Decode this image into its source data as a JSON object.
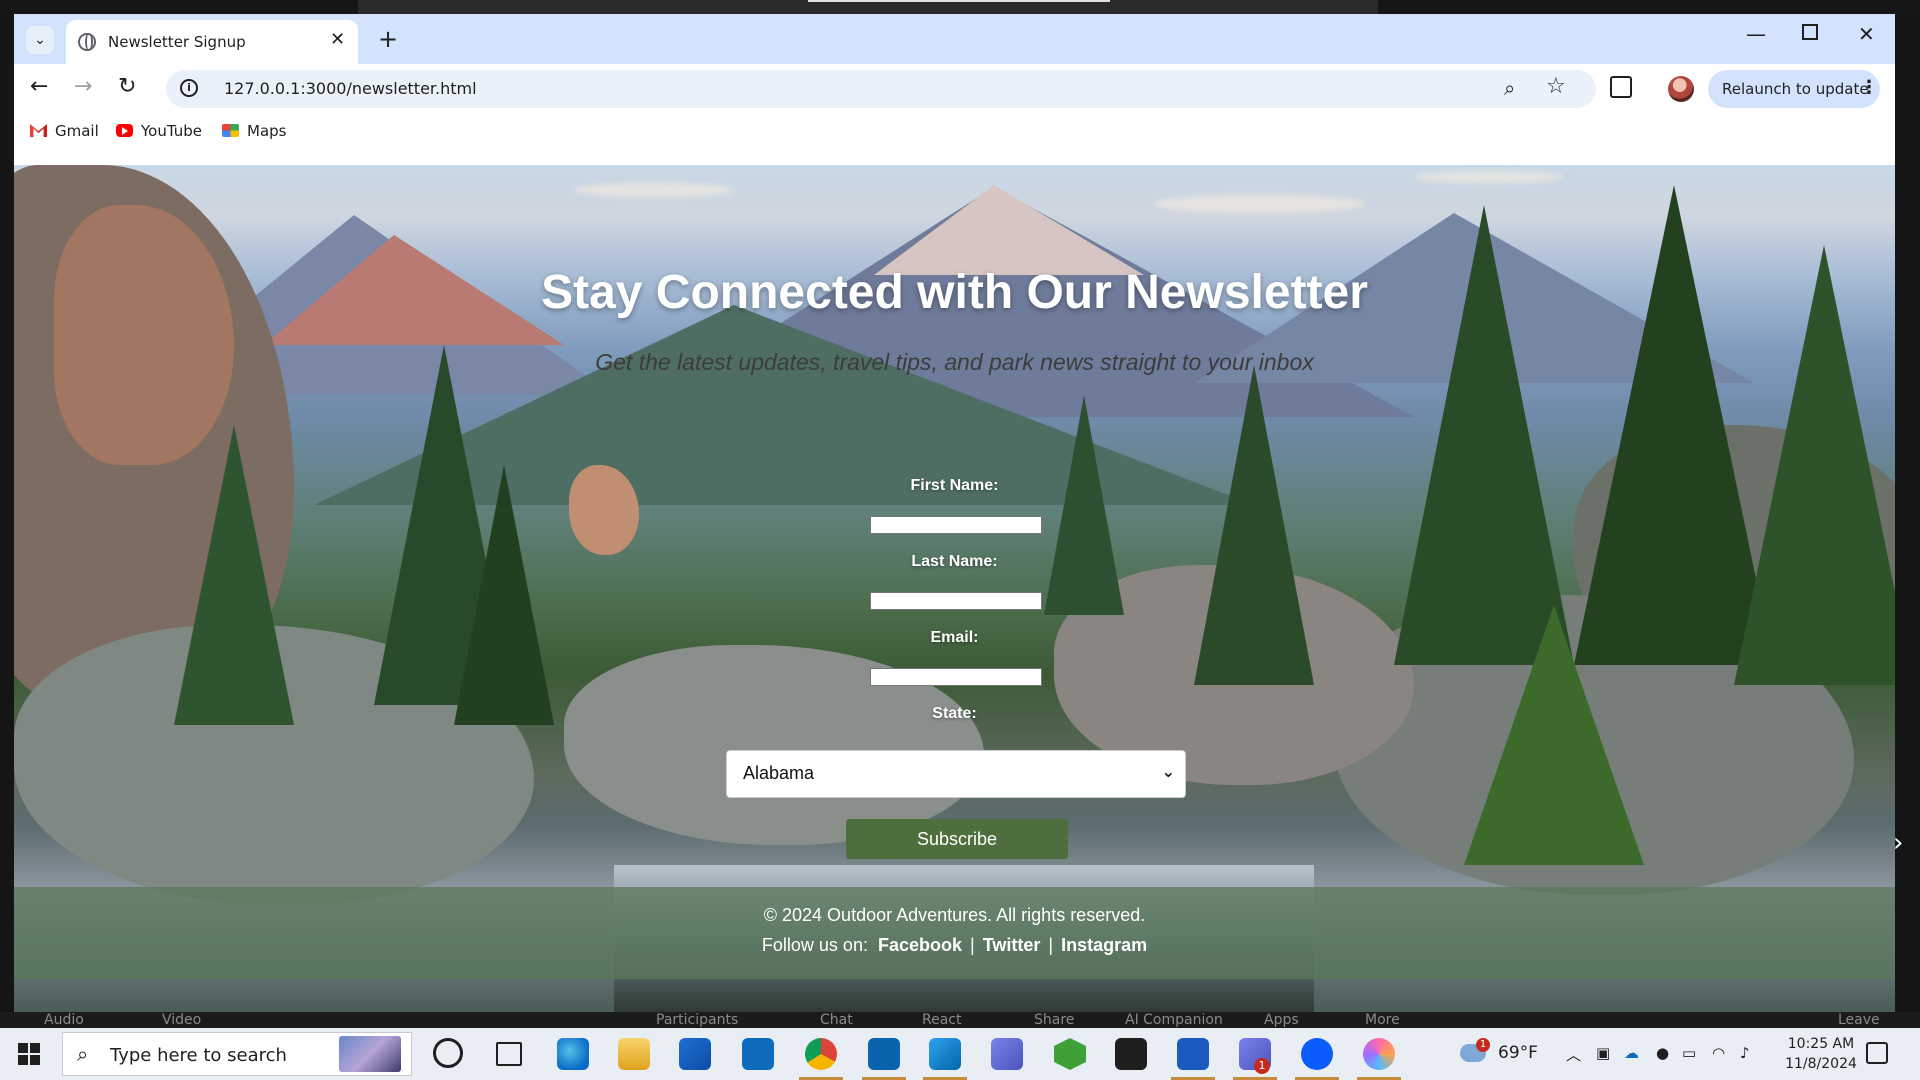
{
  "zoom_meeting": {
    "controls": [
      "Audio",
      "Video",
      "Participants",
      "Chat",
      "React",
      "Share",
      "AI Companion",
      "Apps",
      "More",
      "Leave"
    ]
  },
  "browser": {
    "tab_title": "Newsletter Signup",
    "new_tab_symbol": "+",
    "url": "127.0.0.1:3000/newsletter.html",
    "relaunch_label": "Relaunch to update",
    "bookmarks": [
      "Gmail",
      "YouTube",
      "Maps"
    ]
  },
  "page": {
    "title": "Stay Connected with Our Newsletter",
    "subtitle": "Get the latest updates, travel tips, and park news straight to your inbox",
    "form": {
      "first_name_label": "First Name:",
      "last_name_label": "Last Name:",
      "email_label": "Email:",
      "state_label": "State:",
      "state_value": "Alabama",
      "first_name_value": "",
      "last_name_value": "",
      "email_value": "",
      "subscribe_label": "Subscribe"
    },
    "footer": {
      "copyright": "© 2024 Outdoor Adventures. All rights reserved.",
      "follow_label": "Follow us on:",
      "links": [
        "Facebook",
        "Twitter",
        "Instagram"
      ],
      "separator": "|"
    }
  },
  "taskbar": {
    "search_placeholder": "Type here to search",
    "weather": "69°F",
    "weather_badge": "1",
    "teams_badge": "1",
    "time": "10:25 AM",
    "date": "11/8/2024"
  },
  "colors": {
    "tab_strip": "#d3e3fd",
    "subscribe_button": "#4f6e3e",
    "footer_bg": "#5a785a"
  }
}
